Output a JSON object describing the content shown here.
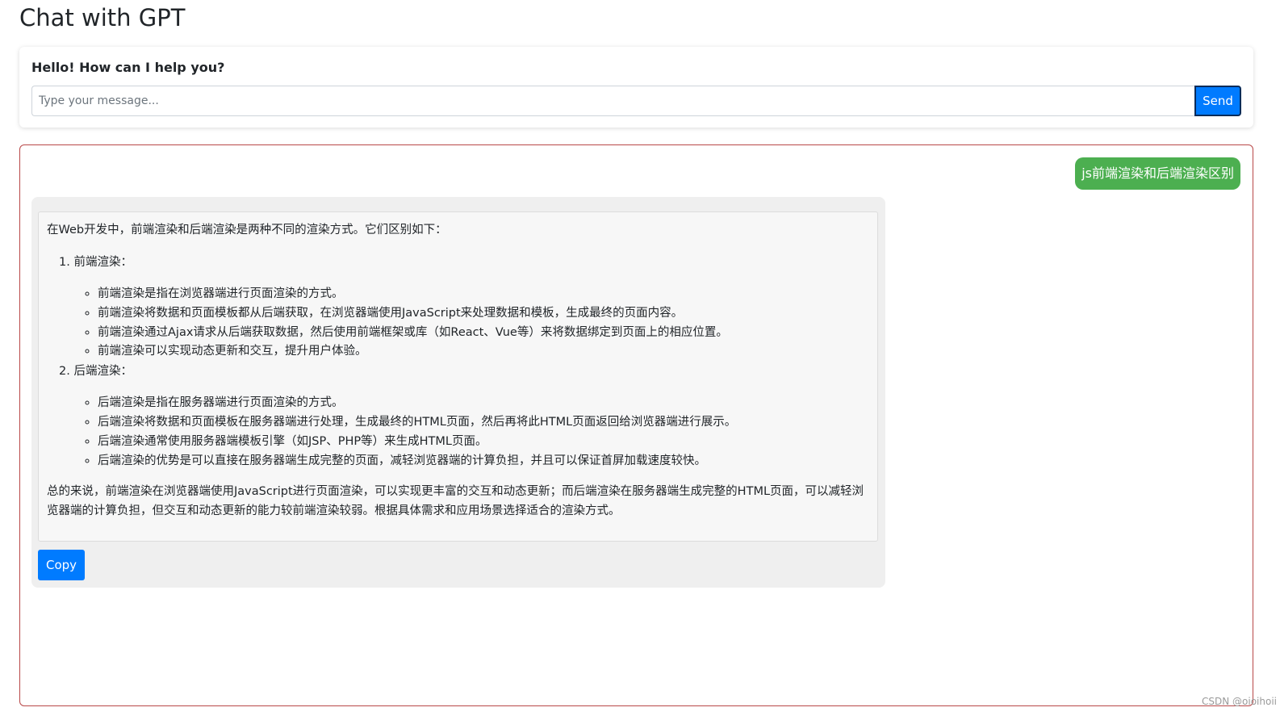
{
  "page": {
    "title": "Chat with GPT"
  },
  "input_card": {
    "prompt_label": "Hello! How can I help you?",
    "input_placeholder": "Type your message...",
    "input_value": "",
    "send_label": "Send"
  },
  "chat": {
    "user_message": "js前端渲染和后端渲染区别",
    "bot_reply": {
      "intro": "在Web开发中，前端渲染和后端渲染是两种不同的渲染方式。它们区别如下：",
      "sections": [
        {
          "title": "1. 前端渲染：",
          "bullets": [
            "前端渲染是指在浏览器端进行页面渲染的方式。",
            "前端渲染将数据和页面模板都从后端获取，在浏览器端使用JavaScript来处理数据和模板，生成最终的页面内容。",
            "前端渲染通过Ajax请求从后端获取数据，然后使用前端框架或库（如React、Vue等）来将数据绑定到页面上的相应位置。",
            "前端渲染可以实现动态更新和交互，提升用户体验。"
          ]
        },
        {
          "title": "2. 后端渲染：",
          "bullets": [
            "后端渲染是指在服务器端进行页面渲染的方式。",
            "后端渲染将数据和页面模板在服务器端进行处理，生成最终的HTML页面，然后再将此HTML页面返回给浏览器端进行展示。",
            "后端渲染通常使用服务器端模板引擎（如JSP、PHP等）来生成HTML页面。",
            "后端渲染的优势是可以直接在服务器端生成完整的页面，减轻浏览器端的计算负担，并且可以保证首屏加载速度较快。"
          ]
        }
      ],
      "summary": "总的来说，前端渲染在浏览器端使用JavaScript进行页面渲染，可以实现更丰富的交互和动态更新；而后端渲染在服务器端生成完整的HTML页面，可以减轻浏览器端的计算负担，但交互和动态更新的能力较前端渲染较弱。根据具体需求和应用场景选择适合的渲染方式。",
      "copy_label": "Copy"
    }
  },
  "watermark": "CSDN @oioihoii",
  "colors": {
    "primary_button": "#007bff",
    "user_bubble": "#4caf50",
    "bot_bubble": "#efefef",
    "chat_border": "#b84848"
  }
}
